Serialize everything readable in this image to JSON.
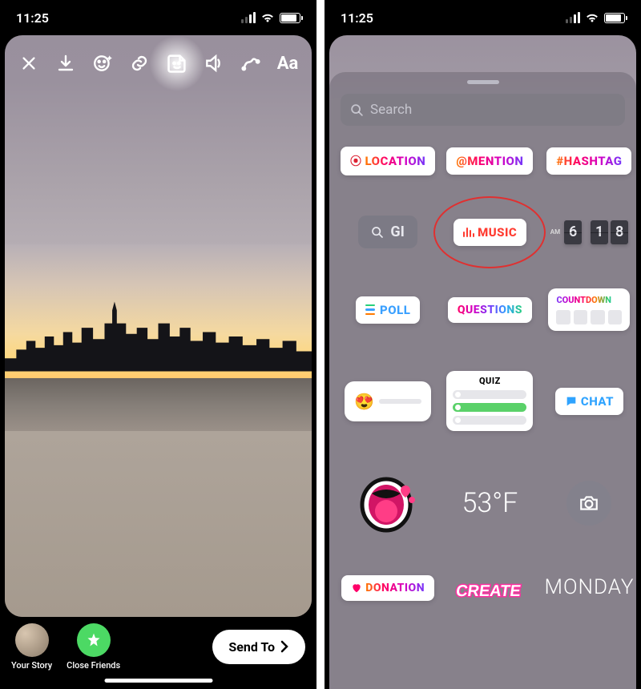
{
  "status": {
    "time": "11:25"
  },
  "left": {
    "toolbar_icons": [
      "close",
      "download",
      "face",
      "link",
      "sticker",
      "sound",
      "scribble",
      "text"
    ],
    "your_story_label": "Your Story",
    "close_friends_label": "Close Friends",
    "send_to_label": "Send To"
  },
  "right": {
    "search_placeholder": "Search",
    "stickers": {
      "location": "LOCATION",
      "mention": "@MENTION",
      "hashtag": "#HASHTAG",
      "gif": "GI",
      "music": "MUSIC",
      "clock_ampm": "AM",
      "clock_digits": [
        "6",
        "1",
        "8"
      ],
      "poll": "POLL",
      "questions": "QUESTIONS",
      "countdown": "COUNTDOWN",
      "slider_emoji": "😍",
      "quiz": "QUIZ",
      "chat": "CHAT",
      "temperature": "53°F",
      "donation": "DONATION",
      "day": "MONDAY"
    }
  }
}
